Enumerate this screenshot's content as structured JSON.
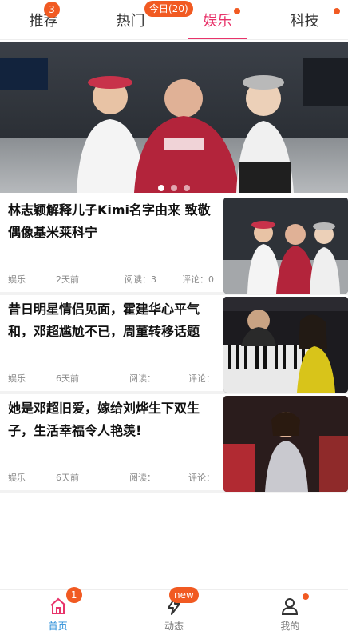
{
  "tabs": [
    {
      "label": "推荐",
      "badge": "3"
    },
    {
      "label": "热门",
      "badge": "今日(20)"
    },
    {
      "label": "娱乐",
      "badge": ""
    },
    {
      "label": "科技",
      "badge": ""
    }
  ],
  "active_tab": "娱乐",
  "accent_color": "#e8336a",
  "badge_color": "#f15a22",
  "banner": {
    "active_dot": 0,
    "dot_count": 3
  },
  "articles": [
    {
      "title": "林志颖解释儿子Kimi名字由来 致敬偶像基米莱科宁",
      "category": "娱乐",
      "time": "2天前",
      "reads_label": "阅读：",
      "reads": "3",
      "comments_label": "评论：",
      "comments": "0"
    },
    {
      "title": "昔日明星情侣见面，霍建华心平气和，邓超尴尬不已，周董转移话题",
      "category": "娱乐",
      "time": "6天前",
      "reads_label": "阅读：",
      "reads": "",
      "comments_label": "评论：",
      "comments": ""
    },
    {
      "title": "她是邓超旧爱，嫁给刘烨生下双生子，生活幸福令人艳羡!",
      "category": "娱乐",
      "time": "6天前",
      "reads_label": "阅读：",
      "reads": "",
      "comments_label": "评论：",
      "comments": ""
    }
  ],
  "bottom_nav": [
    {
      "label": "首页",
      "icon": "home-icon",
      "badge": "1"
    },
    {
      "label": "动态",
      "icon": "lightning-icon",
      "badge": "new"
    },
    {
      "label": "我的",
      "icon": "user-icon",
      "badge": ""
    }
  ],
  "active_nav_color": "#2a8ed8"
}
